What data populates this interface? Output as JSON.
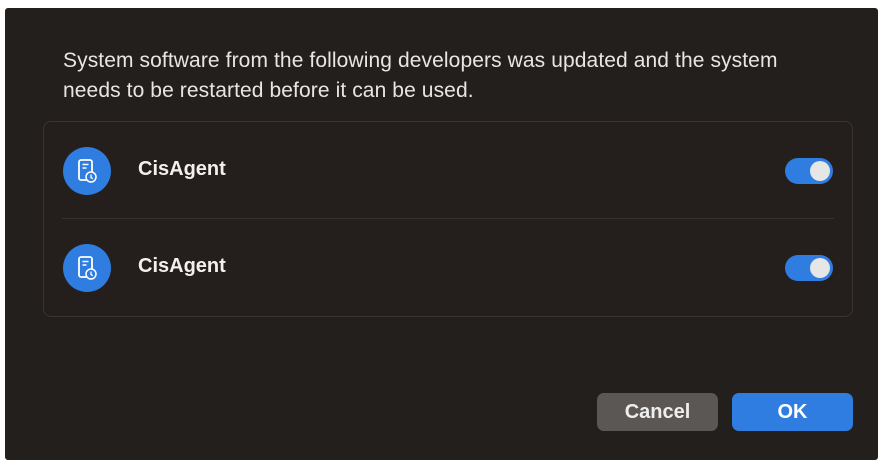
{
  "dialog": {
    "message": "System software from the following developers was updated and the system needs to be restarted before it can be used.",
    "extensions": [
      {
        "name": "CisAgent",
        "icon": "system-extension-icon",
        "enabled": true
      },
      {
        "name": "CisAgent",
        "icon": "system-extension-icon",
        "enabled": true
      }
    ],
    "buttons": {
      "cancel_label": "Cancel",
      "ok_label": "OK"
    }
  },
  "colors": {
    "background": "#231f1c",
    "accent": "#2f7de0",
    "secondary_button": "#5b5754",
    "text": "#e8e6e3"
  }
}
